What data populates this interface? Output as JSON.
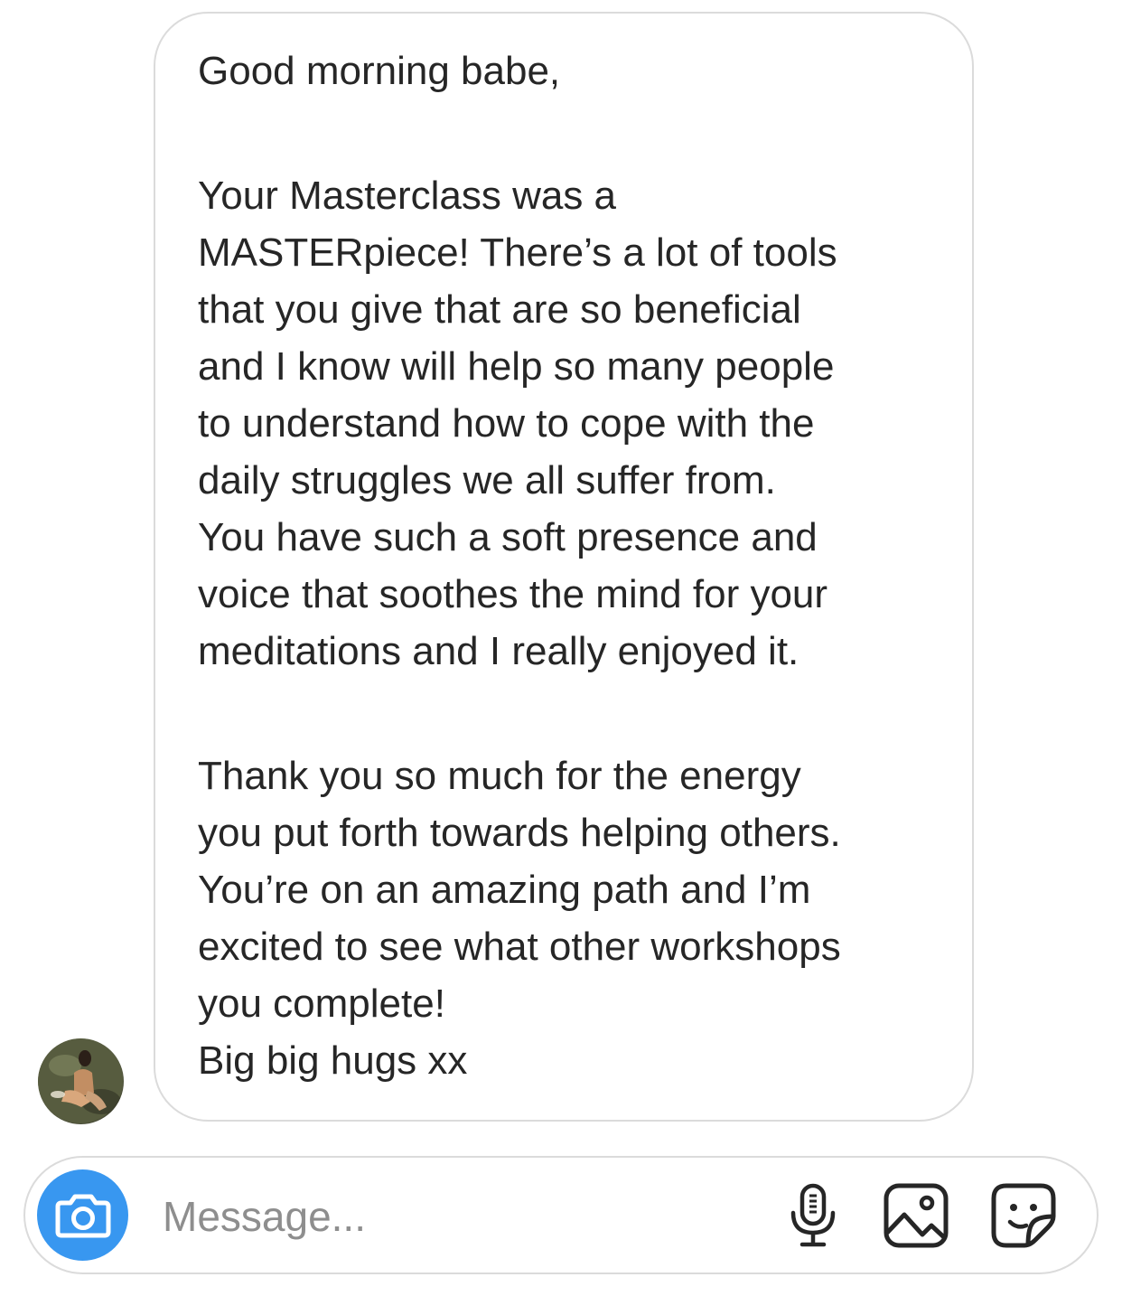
{
  "message": {
    "lines": [
      "Good morning babe,",
      "",
      "Your Masterclass was a",
      "MASTERpiece! There’s a lot of tools",
      "that you give that are so beneficial",
      "and I know will help so many people",
      "to understand how to cope with the",
      "daily struggles we all suffer from.",
      "You have such a soft presence and",
      "voice that soothes the mind for your",
      "meditations and I really enjoyed it.",
      "",
      "Thank you so much for the energy",
      "you put forth towards helping others.",
      "You’re on an amazing path and I’m",
      "excited to see what other workshops",
      "you complete!",
      "Big big hugs xx"
    ]
  },
  "composer": {
    "placeholder": "Message...",
    "value": ""
  },
  "icons": {
    "camera": "camera-icon",
    "mic": "microphone-icon",
    "gallery": "image-gallery-icon",
    "sticker": "sticker-icon"
  },
  "colors": {
    "camera_button": "#3897f0",
    "text": "#262626",
    "placeholder": "#8e8e8e",
    "border": "#dbdbdb"
  }
}
